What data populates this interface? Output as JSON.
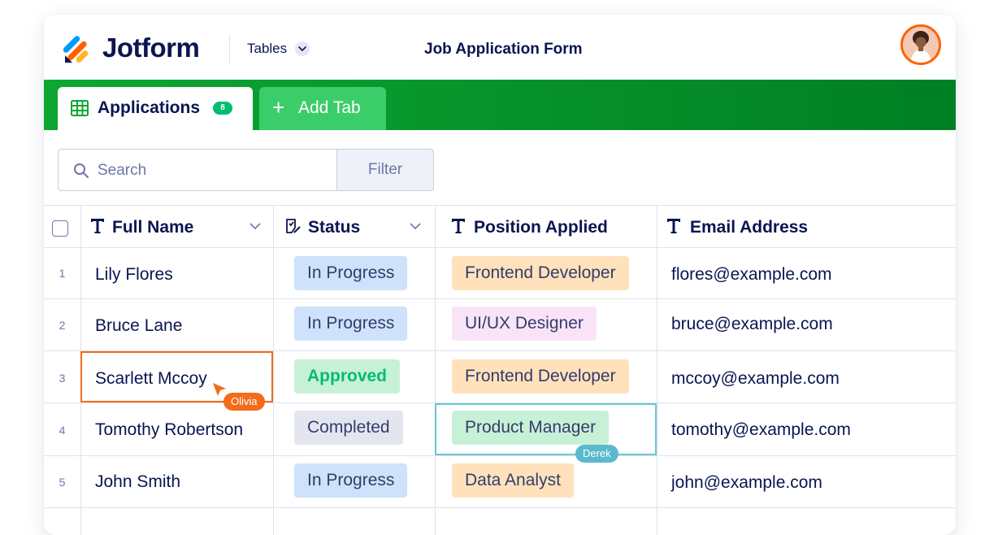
{
  "header": {
    "logo_text": "Jotform",
    "tables_label": "Tables",
    "form_title": "Job Application Form"
  },
  "tabs": {
    "active_label": "Applications",
    "active_count": "8",
    "add_label": "Add Tab"
  },
  "toolbar": {
    "search_placeholder": "Search",
    "filter_label": "Filter"
  },
  "columns": [
    "Full Name",
    "Status",
    "Position Applied",
    "Email Address"
  ],
  "rows": [
    {
      "num": "1",
      "name": "Lily Flores",
      "status": "In Progress",
      "position": "Frontend Developer",
      "email": "flores@example.com"
    },
    {
      "num": "2",
      "name": "Bruce Lane",
      "status": "In Progress",
      "position": "UI/UX Designer",
      "email": "bruce@example.com"
    },
    {
      "num": "3",
      "name": "Scarlett Mccoy",
      "status": "Approved",
      "position": "Frontend Developer",
      "email": "mccoy@example.com"
    },
    {
      "num": "4",
      "name": "Tomothy Robertson",
      "status": "Completed",
      "position": "Product Manager",
      "email": "tomothy@example.com"
    },
    {
      "num": "5",
      "name": "John Smith",
      "status": "In Progress",
      "position": "Data Analyst",
      "email": "john@example.com"
    }
  ],
  "collaborators": {
    "cursor_one": "Olivia",
    "cursor_two": "Derek"
  },
  "colors": {
    "brand_navy": "#0a1551",
    "tab_bar_green": "#0da732",
    "selection_orange": "#f36c1a",
    "selection_blue": "#68c6d6"
  }
}
